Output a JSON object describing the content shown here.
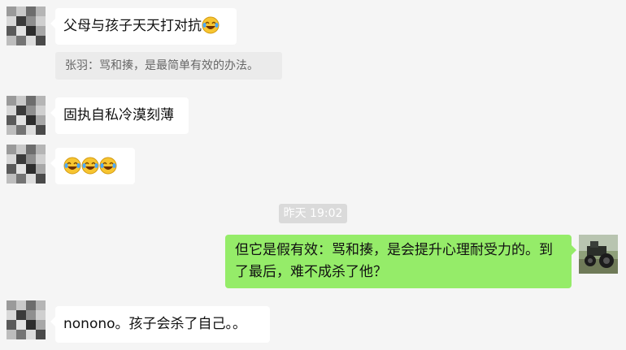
{
  "messages": [
    {
      "side": "left",
      "text": "父母与孩子天天打对抗",
      "emoji_suffix": "laugh-cry-icon"
    },
    {
      "side": "left",
      "quote": "张羽：骂和揍，是最简单有效的办法。"
    },
    {
      "side": "left",
      "text": "固执自私冷漠刻薄"
    },
    {
      "side": "left",
      "emojis": [
        "laugh-cry-icon",
        "laugh-cry-icon",
        "laugh-cry-icon"
      ]
    },
    {
      "side": "center",
      "timestamp": "昨天 19:02"
    },
    {
      "side": "right",
      "lines": [
        "但它是假有效：骂和揍，是会提升心理耐受力的。到",
        "了最后，难不成杀了他？"
      ]
    },
    {
      "side": "left",
      "text": "nonono。孩子会杀了自己。。"
    }
  ],
  "avatars": {
    "left": "pixelated-avatar",
    "right": "tractor-photo-avatar"
  },
  "colors": {
    "background": "#f5f5f5",
    "incoming_bubble": "#ffffff",
    "outgoing_bubble": "#95ec69",
    "quote_bg": "#ebebeb",
    "timestamp_bg": "#dadada"
  }
}
